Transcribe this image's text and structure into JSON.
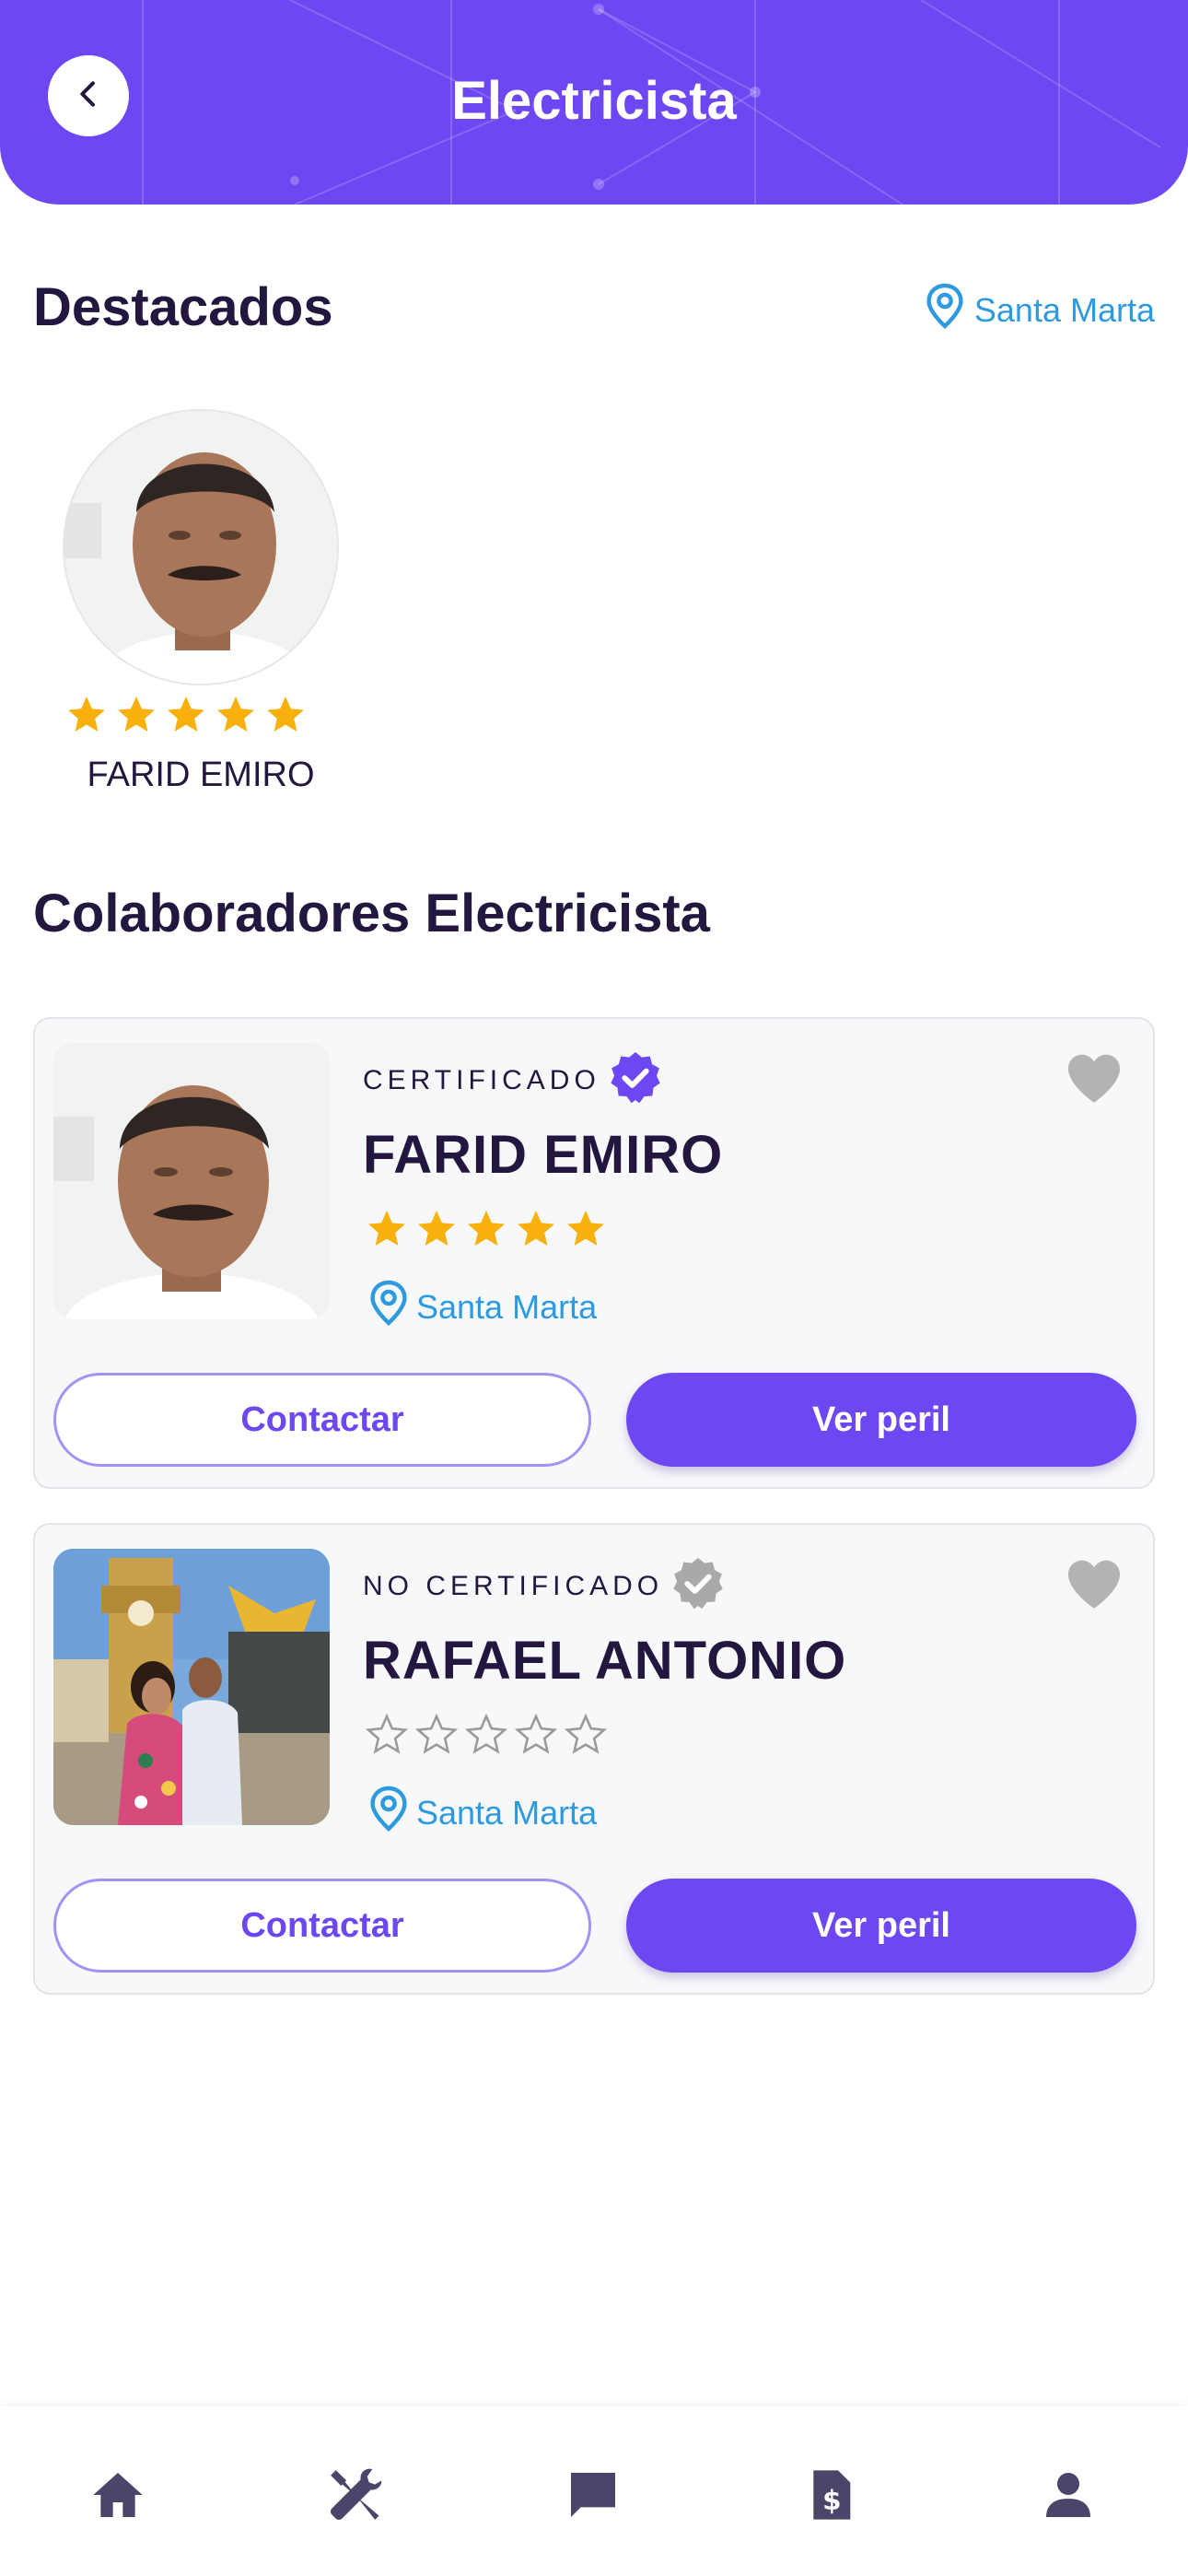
{
  "header": {
    "title": "Electricista",
    "back_icon": "chevron-left-icon"
  },
  "featured": {
    "title": "Destacados",
    "location": "Santa Marta",
    "items": [
      {
        "name": "FARID EMIRO",
        "rating": 5
      }
    ]
  },
  "collaborators": {
    "title": "Colaboradores Electricista",
    "items": [
      {
        "certified_label": "CERTIFICADO",
        "certified": true,
        "name": "FARID EMIRO",
        "rating": 5,
        "location": "Santa Marta",
        "contact_label": "Contactar",
        "profile_label": "Ver peril"
      },
      {
        "certified_label": "NO CERTIFICADO",
        "certified": false,
        "name": "RAFAEL ANTONIO",
        "rating": 0,
        "location": "Santa Marta",
        "contact_label": "Contactar",
        "profile_label": "Ver peril"
      }
    ]
  },
  "bottom_nav": {
    "items": [
      {
        "icon": "home-icon"
      },
      {
        "icon": "tools-icon"
      },
      {
        "icon": "chat-icon"
      },
      {
        "icon": "invoice-icon"
      },
      {
        "icon": "user-icon"
      }
    ]
  },
  "colors": {
    "primary": "#6c47f2",
    "dark_text": "#24173f",
    "location_blue": "#2d9ae0",
    "star_gold": "#f8b00c",
    "nav_icon": "#4a4569"
  }
}
